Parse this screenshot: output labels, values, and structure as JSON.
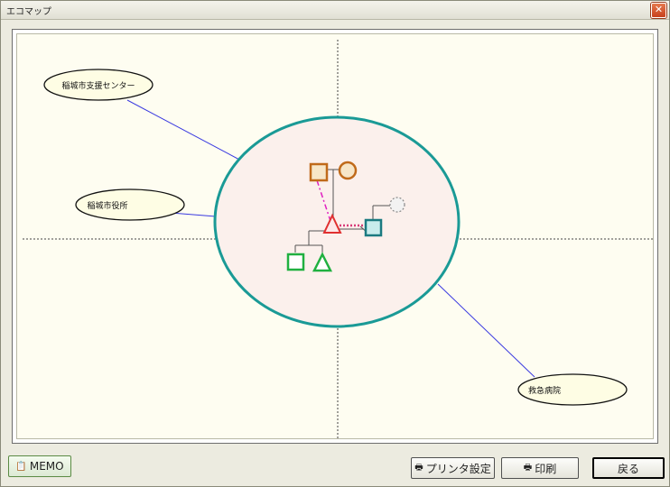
{
  "window": {
    "title": "エコマップ",
    "close_symbol": "✕"
  },
  "map": {
    "nodes": [
      {
        "label": "稲城市支援センター"
      },
      {
        "label": "稲城市役所"
      },
      {
        "label": "救急病院"
      }
    ],
    "center_ring_color": "#1a9a96",
    "center_fill": "#fbf0ec",
    "connector_color": "#3a3ae0"
  },
  "buttons": {
    "memo": "MEMO",
    "printer_settings": "プリンタ設定",
    "print": "印刷",
    "back": "戻る"
  }
}
